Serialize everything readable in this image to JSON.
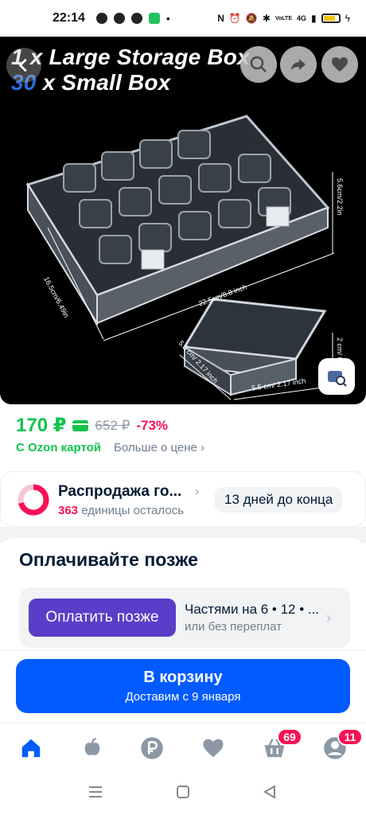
{
  "status_bar": {
    "time": "22:14",
    "net": "4G",
    "lte": "VoLTE"
  },
  "hero": {
    "title_line1": "1 x Large Storage Box",
    "title_line2_num": "30",
    "title_line2_rest": " x Small Box",
    "dims": {
      "height_large": "5.6cm/2.2in",
      "depth_large": "16.5cm/6.49in",
      "width_large": "22.5cm/8.8 inch",
      "height_small": "2 cm/ 0.79 inch",
      "depth_small": "5.5 cm/ 2.17 inch",
      "width_small": "5.5 cm/ 2.17 inch"
    }
  },
  "price": {
    "current": "170 ₽",
    "old": "652 ₽",
    "discount": "-73%",
    "ozon_card": "С Ozon картой",
    "more_price": "Больше о цене"
  },
  "sale": {
    "title": "Распродажа го...",
    "count": "363",
    "units_left": " единицы осталось",
    "days_left": "13 дней до конца"
  },
  "pay_later": {
    "title": "Оплачивайте позже",
    "button": "Оплатить позже",
    "installments": "Частями на 6 • 12 • ...",
    "no_overpay": "или без переплат"
  },
  "cart": {
    "button_title": "В корзину",
    "button_sub": "Доставим с 9 января"
  },
  "bottom_nav": {
    "cart_badge": "69",
    "profile_badge": "11"
  },
  "colors": {
    "brand_blue": "#005bff",
    "ozon_green": "#10c44c",
    "sale_pink": "#f91155",
    "pay_later_purple": "#5a3dc8"
  }
}
